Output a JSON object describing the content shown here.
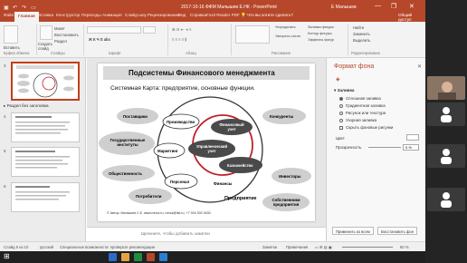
{
  "window": {
    "title": "2017-10-16 ФФМ Малышев Е.НК - PowerPoint",
    "user": "Е Малышев",
    "controls": [
      "—",
      "❐",
      "✕"
    ]
  },
  "ribbon_tabs": [
    "Файл",
    "Главная",
    "Вставка",
    "Конструктор",
    "Переходы",
    "Анимация",
    "Слайд-шоу",
    "Рецензирование",
    "Вид",
    "Справка",
    "Foxit Reader PDF"
  ],
  "search_tip": "Что вы хотите сделать?",
  "share_label": "Общий доступ",
  "ribbon": {
    "paste": "Вставить",
    "create_slide": "Создать слайд",
    "layout": "Макет",
    "reset": "Восстановить",
    "section": "Раздел",
    "groups": [
      "Буфер обмена",
      "Слайды",
      "Шрифт",
      "Абзац",
      "Рисование",
      "Редактирование"
    ],
    "find": "Найти",
    "replace": "Заменить",
    "select": "Выделить",
    "fill": "Заливка фигуры",
    "outline": "Контур фигуры",
    "effects": "Эффекты фигур",
    "arrange": "Упорядочить",
    "styles": "Экспресс-стили"
  },
  "thumbnails": {
    "section_label": "Раздел без заголовка",
    "numbers": [
      "3",
      "4",
      "5",
      "6"
    ]
  },
  "slide": {
    "title": "Подсистемы Финансового менеджмента",
    "subtitle": "Системная Карта: предприятие, основные функции.",
    "footer": "© Автор: Малышев С.Е. www.mmul.ru, mmul@list.ru, +7 916 300 3430",
    "outer": {
      "suppliers": "Поставщики",
      "gov": "Государственные институты",
      "society": "Общественность",
      "consumers": "Потребители",
      "competitors": "Конкуренты",
      "investors": "Инвесторы",
      "owners": "Собственники предприятия"
    },
    "inner": {
      "production": "Производство",
      "marketing": "Маркетинг",
      "personnel": "Персонал",
      "finance": "Финансы",
      "fin_accounting": "Финансовый учет",
      "mgmt_accounting": "Управленческий учет",
      "treasury": "Казначейство",
      "enterprise": "Предприятие"
    }
  },
  "notes_placeholder": "Щелкните, чтобы добавить заметки",
  "format_pane": {
    "title": "Формат фона",
    "fill_header": "Заливка",
    "options": [
      "Сплошная заливка",
      "Градиентная заливка",
      "Рисунок или текстура",
      "Узорная заливка",
      "Скрыть фоновые рисунки"
    ],
    "color_label": "Цвет",
    "transparency_label": "Прозрачность",
    "transparency_value": "0 %",
    "apply_all": "Применить ко всем",
    "reset_bg": "Восстановить фон"
  },
  "status": {
    "slide": "Слайд 5 из 10",
    "lang": "русский",
    "accessibility": "Специальные возможности: проверьте рекомендации",
    "notes": "Заметки",
    "comments": "Примечания",
    "zoom": "60 %"
  },
  "colors": {
    "accent": "#b7472a",
    "ring": "#c0202a"
  }
}
